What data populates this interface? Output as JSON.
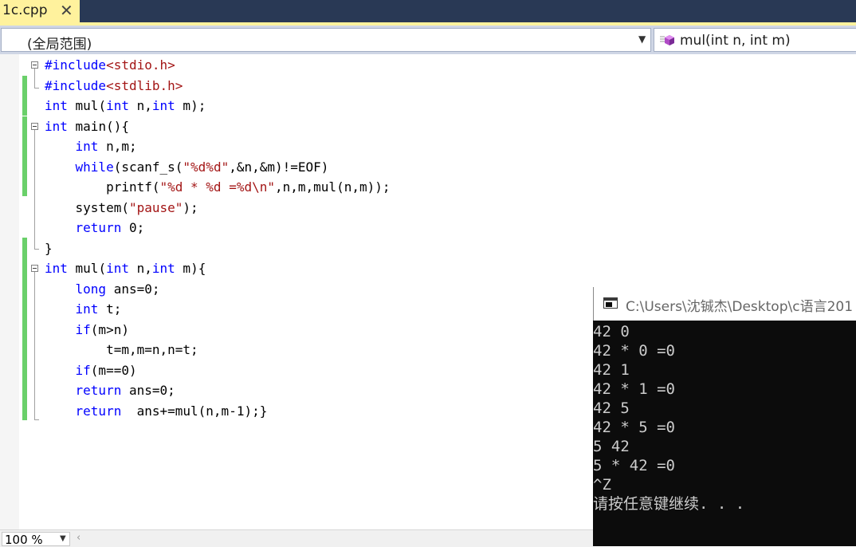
{
  "tab": {
    "filename": "1c.cpp",
    "close_glyph": "✕"
  },
  "navbar": {
    "scope": "(全局范围)",
    "member": "mul(int n, int m)",
    "member_icon": "method-icon"
  },
  "editor": {
    "lines": [
      [
        {
          "t": "#include",
          "c": "kw"
        },
        {
          "t": "<stdio.h>",
          "c": "str"
        }
      ],
      [
        {
          "t": "#include",
          "c": "kw"
        },
        {
          "t": "<stdlib.h>",
          "c": "str"
        }
      ],
      [
        {
          "t": "int",
          "c": "kw"
        },
        {
          "t": " mul(",
          "c": ""
        },
        {
          "t": "int",
          "c": "kw"
        },
        {
          "t": " n,",
          "c": ""
        },
        {
          "t": "int",
          "c": "kw"
        },
        {
          "t": " m);",
          "c": ""
        }
      ],
      [
        {
          "t": "int",
          "c": "kw"
        },
        {
          "t": " main(){",
          "c": ""
        }
      ],
      [
        {
          "t": "    ",
          "c": ""
        },
        {
          "t": "int",
          "c": "kw"
        },
        {
          "t": " n,m;",
          "c": ""
        }
      ],
      [
        {
          "t": "    ",
          "c": ""
        },
        {
          "t": "while",
          "c": "kw"
        },
        {
          "t": "(scanf_s(",
          "c": ""
        },
        {
          "t": "\"%d%d\"",
          "c": "str"
        },
        {
          "t": ",&n,&m)!=EOF)",
          "c": ""
        }
      ],
      [
        {
          "t": "        printf(",
          "c": ""
        },
        {
          "t": "\"%d * %d =%d\\n\"",
          "c": "str"
        },
        {
          "t": ",n,m,mul(n,m));",
          "c": ""
        }
      ],
      [
        {
          "t": "    system(",
          "c": ""
        },
        {
          "t": "\"pause\"",
          "c": "str"
        },
        {
          "t": ");",
          "c": ""
        }
      ],
      [
        {
          "t": "    ",
          "c": ""
        },
        {
          "t": "return",
          "c": "kw"
        },
        {
          "t": " 0;",
          "c": ""
        }
      ],
      [
        {
          "t": "}",
          "c": ""
        }
      ],
      [
        {
          "t": "int",
          "c": "kw"
        },
        {
          "t": " mul(",
          "c": ""
        },
        {
          "t": "int",
          "c": "kw"
        },
        {
          "t": " n,",
          "c": ""
        },
        {
          "t": "int",
          "c": "kw"
        },
        {
          "t": " m){",
          "c": ""
        }
      ],
      [
        {
          "t": "    ",
          "c": ""
        },
        {
          "t": "long",
          "c": "kw"
        },
        {
          "t": " ans=0;",
          "c": ""
        }
      ],
      [
        {
          "t": "    ",
          "c": ""
        },
        {
          "t": "int",
          "c": "kw"
        },
        {
          "t": " t;",
          "c": ""
        }
      ],
      [
        {
          "t": "    ",
          "c": ""
        },
        {
          "t": "if",
          "c": "kw"
        },
        {
          "t": "(m>n)",
          "c": ""
        }
      ],
      [
        {
          "t": "        t=m,m=n,n=t;",
          "c": ""
        }
      ],
      [
        {
          "t": "    ",
          "c": ""
        },
        {
          "t": "if",
          "c": "kw"
        },
        {
          "t": "(m==0)",
          "c": ""
        }
      ],
      [
        {
          "t": "    ",
          "c": ""
        },
        {
          "t": "return",
          "c": "kw"
        },
        {
          "t": " ans=0;",
          "c": ""
        }
      ],
      [
        {
          "t": "    ",
          "c": ""
        },
        {
          "t": "return",
          "c": "kw"
        },
        {
          "t": "  ans+=mul(n,m-1);}",
          "c": ""
        }
      ]
    ]
  },
  "status": {
    "zoom": "100 %",
    "scroll_left_glyph": "‹"
  },
  "console": {
    "title": "C:\\Users\\沈铖杰\\Desktop\\c语言201",
    "lines": [
      "42 0",
      "42 * 0 =0",
      "42 1",
      "42 * 1 =0",
      "42 5",
      "42 * 5 =0",
      "5 42",
      "5 * 42 =0",
      "^Z",
      "请按任意键继续. . ."
    ]
  },
  "colors": {
    "keyword": "#0000ff",
    "string": "#a31515",
    "change_bar": "#6ad06a",
    "tab_active": "#fff29d",
    "tabstrip": "#293955"
  }
}
